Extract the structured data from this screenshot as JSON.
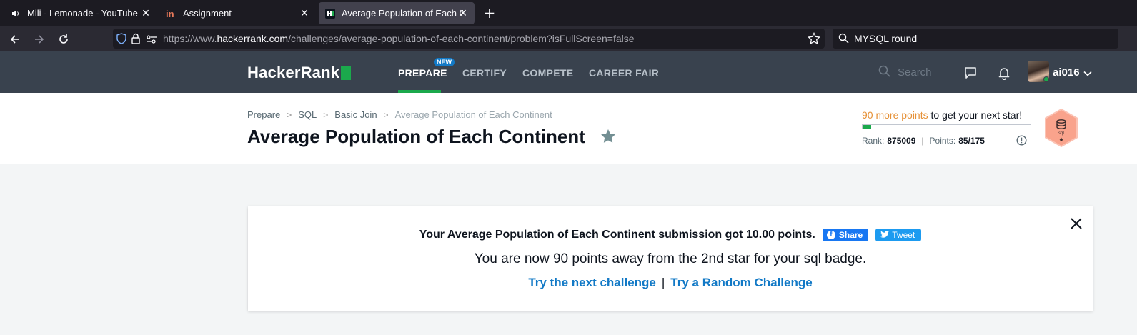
{
  "browser": {
    "tabs": [
      {
        "title": "Mili - Lemonade - YouTube",
        "icon": "speaker-icon"
      },
      {
        "title": "Assignment",
        "icon": "invision-icon"
      },
      {
        "title": "Average Population of Each Cor",
        "icon": "hackerrank-icon",
        "active": true
      }
    ],
    "url_prefix": "https://www.",
    "url_host": "hackerrank.com",
    "url_path": "/challenges/average-population-of-each-continent/problem?isFullScreen=false",
    "search_text": "MYSQL round"
  },
  "header": {
    "logo": "HackerRank",
    "nav": {
      "prepare": "PREPARE",
      "certify": "CERTIFY",
      "compete": "COMPETE",
      "career_fair": "CAREER FAIR"
    },
    "new_badge": "NEW",
    "search_placeholder": "Search",
    "username": "ai016",
    "accent_color": "#1ba94c"
  },
  "challenge": {
    "breadcrumb": {
      "prepare": "Prepare",
      "sql": "SQL",
      "basic_join": "Basic Join",
      "current": "Average Population of Each Continent"
    },
    "title": "Average Population of Each Continent",
    "points_needed": "90 more points",
    "points_suffix": " to get your next star!",
    "progress_fraction": 0.05,
    "rank_label": "Rank:",
    "rank_value": "875009",
    "points_label": "Points:",
    "points_value": "85/175",
    "badge_label": "sql"
  },
  "notification": {
    "message": "Your Average Population of Each Continent submission got 10.00 points.",
    "share_label": "Share",
    "tweet_label": "Tweet",
    "subtitle": "You are now 90 points away from the 2nd star for your sql badge.",
    "next_challenge": "Try the next challenge",
    "separator": "|",
    "random_challenge": "Try a Random Challenge"
  }
}
